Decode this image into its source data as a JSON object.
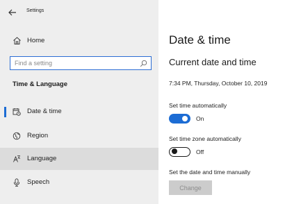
{
  "window": {
    "title": "Settings"
  },
  "sidebar": {
    "home_label": "Home",
    "search": {
      "placeholder": "Find a setting",
      "value": ""
    },
    "section_heading": "Time & Language",
    "items": [
      {
        "label": "Date & time",
        "icon": "calendar-clock-icon",
        "active": true
      },
      {
        "label": "Region",
        "icon": "globe-icon",
        "active": false
      },
      {
        "label": "Language",
        "icon": "language-icon",
        "active": false,
        "hovered": true
      },
      {
        "label": "Speech",
        "icon": "microphone-icon",
        "active": false
      }
    ]
  },
  "main": {
    "title": "Date & time",
    "subheading": "Current date and time",
    "current_datetime": "7:34 PM, Thursday, October 10, 2019",
    "set_time_auto": {
      "label": "Set time automatically",
      "state": "On",
      "enabled": true
    },
    "set_timezone_auto": {
      "label": "Set time zone automatically",
      "state": "Off",
      "enabled": false
    },
    "set_manually": {
      "label": "Set the date and time manually",
      "button_label": "Change",
      "button_disabled": true
    }
  },
  "colors": {
    "accent": "#1c6cd4",
    "sidebar_bg": "#eeeeee",
    "hover_bg": "#dcdcdc",
    "disabled_button_bg": "#cccccc",
    "disabled_button_text": "#8c8c8c"
  }
}
